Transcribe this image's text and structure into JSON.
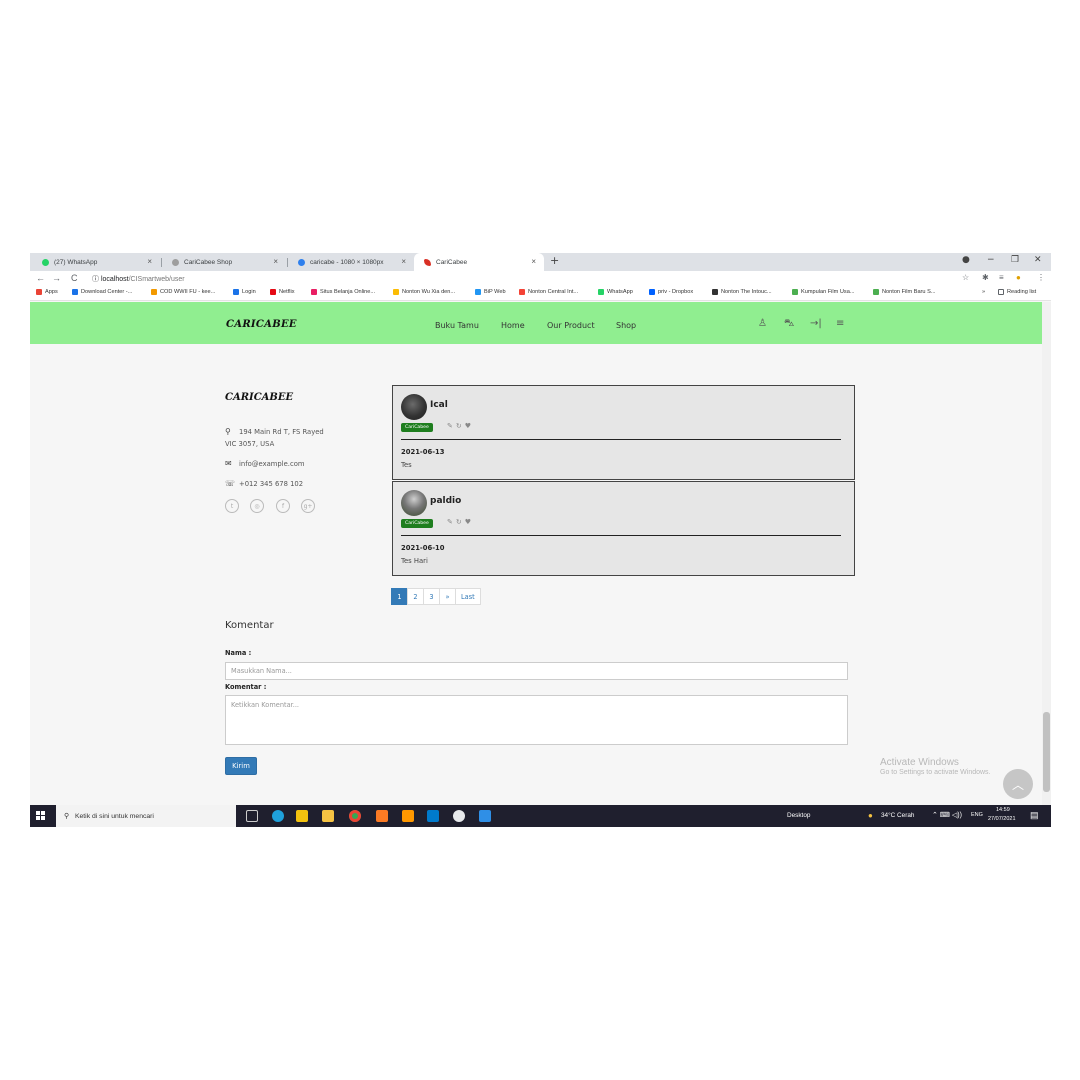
{
  "browser": {
    "tabs": [
      {
        "label": "(27) WhatsApp",
        "icon": "whatsapp-icon",
        "color": "#25d366"
      },
      {
        "label": "CariCabee Shop",
        "icon": "shop-icon",
        "color": "#888888"
      },
      {
        "label": "caricabe - 1080 × 1080px",
        "icon": "canva-icon",
        "color": "#2f80ed"
      },
      {
        "label": "CariCabee",
        "icon": "chili-icon",
        "color": "#d93025"
      }
    ],
    "url_host": "localhost",
    "url_path": "/CISmartweb/user",
    "bookmarks": [
      {
        "label": "Apps",
        "color": "#ea4335"
      },
      {
        "label": "Download Center -...",
        "color": "#1a73e8"
      },
      {
        "label": "COD WWII FU - kee...",
        "color": "#f29900"
      },
      {
        "label": "Login",
        "color": "#1a73e8"
      },
      {
        "label": "Netflix",
        "color": "#e50914"
      },
      {
        "label": "Situs Belanja Online...",
        "color": "#e91e63"
      },
      {
        "label": "Nonton Wu Xia den...",
        "color": "#fbbc04"
      },
      {
        "label": "BiP Web",
        "color": "#2196f3"
      },
      {
        "label": "Nonton Central Int...",
        "color": "#f44336"
      },
      {
        "label": "WhatsApp",
        "color": "#25d366"
      },
      {
        "label": "priv - Dropbox",
        "color": "#0061ff"
      },
      {
        "label": "Nonton The Intouc...",
        "color": "#333333"
      },
      {
        "label": "Kumpulan Film Usa...",
        "color": "#4caf50"
      },
      {
        "label": "Nonton Film Baru S...",
        "color": "#4caf50"
      },
      {
        "label": "Reading list",
        "color": "#5f6368"
      }
    ]
  },
  "site": {
    "logo": "CARICABEE",
    "nav": [
      "Buku Tamu",
      "Home",
      "Our Product",
      "Shop"
    ],
    "nav_icons": [
      "user-icon",
      "cart-icon",
      "logout-icon",
      "menu-icon"
    ],
    "accent": "#90ee90"
  },
  "contact": {
    "brand": "CARICABEE",
    "address_line1": "194 Main Rd T, FS Rayed",
    "address_line2": "VIC 3057, USA",
    "email": "info@example.com",
    "phone": "+012 345 678 102",
    "socials": [
      "twitter-icon",
      "instagram-icon",
      "facebook-icon",
      "google-plus-icon"
    ]
  },
  "comments": [
    {
      "name": "Ical",
      "badge": "CariCabee",
      "date": "2021-06-13",
      "text": "Tes"
    },
    {
      "name": "paldio",
      "badge": "CariCabee",
      "date": "2021-06-10",
      "text": "Tes Hari"
    }
  ],
  "pagination": {
    "pages": [
      "1",
      "2",
      "3",
      "»",
      "Last"
    ],
    "active": "1"
  },
  "form": {
    "title": "Komentar",
    "name_label": "Nama :",
    "name_placeholder": "Masukkan Nama...",
    "comment_label": "Komentar :",
    "comment_placeholder": "Ketikkan Komentar...",
    "submit": "Kirim"
  },
  "watermark": {
    "title": "Activate Windows",
    "subtitle": "Go to Settings to activate Windows."
  },
  "taskbar": {
    "search_placeholder": "Ketik di sini untuk mencari",
    "desktop": "Desktop",
    "weather": "34°C  Cerah",
    "lang": "ENG",
    "time": "14:59",
    "date": "27/07/2021"
  }
}
